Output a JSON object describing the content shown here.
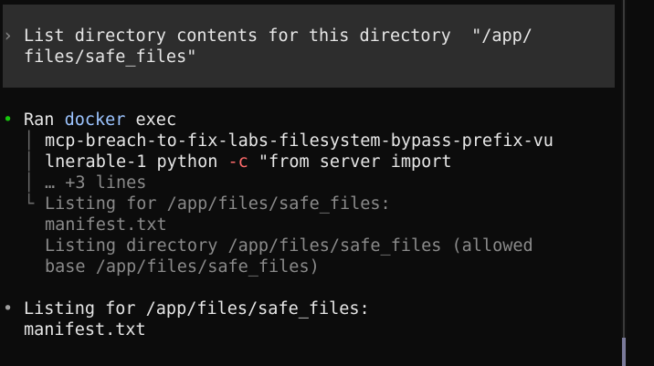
{
  "prompt": {
    "caret": "›",
    "line1": "List directory contents for this directory  \"/app/",
    "line2": "files/safe_files\""
  },
  "ran_block": {
    "bullet": "•",
    "ran_label": "Ran",
    "docker": "docker",
    "exec": "exec",
    "cmd_line1": "mcp-breach-to-fix-labs-filesystem-bypass-prefix-vu",
    "cmd_line2_a": "lnerable-1 python ",
    "cmd_line2_flag": "-c",
    "cmd_line2_b": " \"from server import",
    "more_lines": "… +3 lines",
    "output_lines": [
      "Listing for /app/files/safe_files:",
      "manifest.txt",
      "Listing directory /app/files/safe_files (allowed",
      "base /app/files/safe_files)"
    ],
    "tree_branch": "│",
    "tree_end": "└"
  },
  "result_block": {
    "bullet": "•",
    "line1": "Listing for /app/files/safe_files:",
    "line2": "manifest.txt"
  },
  "colors": {
    "background": "#0c0c0c",
    "prompt_bg": "#2d2d2d",
    "bullet_green": "#16c60c",
    "docker_blue": "#9cc4ff",
    "dim_text": "#8a8a8a"
  }
}
